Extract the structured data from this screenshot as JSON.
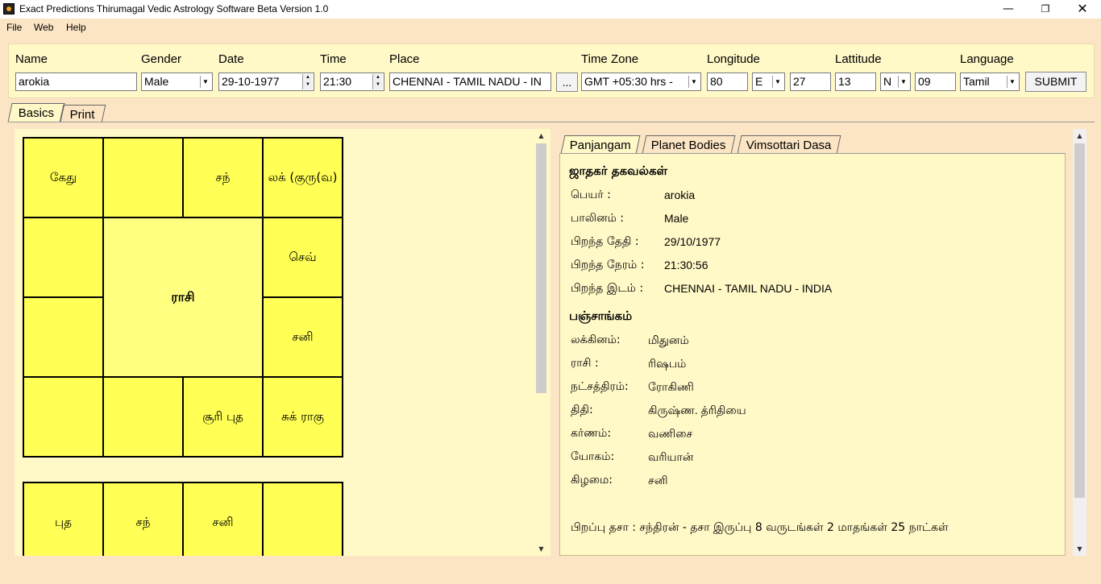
{
  "window": {
    "title": "Exact Predictions Thirumagal Vedic Astrology Software Beta Version 1.0",
    "minimize": "—",
    "maximize": "❐",
    "close": "✕"
  },
  "menu": [
    "File",
    "Web",
    "Help"
  ],
  "form": {
    "name_label": "Name",
    "name_value": "arokia",
    "gender_label": "Gender",
    "gender_value": "Male",
    "date_label": "Date",
    "date_value": "29-10-1977",
    "time_label": "Time",
    "time_value": "21:30",
    "place_label": "Place",
    "place_value": "CHENNAI - TAMIL NADU - IN",
    "browse_label": "...",
    "timezone_label": "Time Zone",
    "timezone_value": "GMT +05:30 hrs -",
    "longitude_label": "Longitude",
    "longitude_deg": "80",
    "longitude_dir": "E",
    "longitude_min": "27",
    "latitude_label": "Lattitude",
    "latitude_deg": "13",
    "latitude_dir": "N",
    "latitude_min": "09",
    "language_label": "Language",
    "language_value": "Tamil",
    "submit_label": "SUBMIT"
  },
  "main_tabs": [
    "Basics",
    "Print"
  ],
  "rasi_chart": {
    "center_label": "ராசி",
    "cells": [
      "கேது",
      "",
      "சந்",
      "லக் (குரு(வ)",
      "",
      "செவ்",
      "",
      "சனி",
      "",
      "",
      "சூரி புத",
      "சுக் ராகு"
    ]
  },
  "second_chart": {
    "cells": [
      "புத",
      "சந்",
      "சனி",
      ""
    ]
  },
  "info_tabs": [
    "Panjangam",
    "Planet Bodies",
    "Vimsottari Dasa"
  ],
  "panjangam": {
    "person_heading": "ஜாதகர் தகவல்கள்",
    "person_rows": [
      {
        "key": "பெயர் :",
        "value": "arokia"
      },
      {
        "key": "பாலினம் :",
        "value": "Male"
      },
      {
        "key": "பிறந்த தேதி :",
        "value": "29/10/1977"
      },
      {
        "key": "பிறந்த நேரம் :",
        "value": "21:30:56"
      },
      {
        "key": "பிறந்த இடம் :",
        "value": "CHENNAI - TAMIL NADU - INDIA"
      }
    ],
    "panchang_heading": "பஞ்சாங்கம்",
    "panchang_rows": [
      {
        "key": "லக்கினம்:",
        "value": "மிதுனம்"
      },
      {
        "key": "ராசி :",
        "value": "ரிஷபம்"
      },
      {
        "key": "நட்சத்திரம்:",
        "value": "ரோகிணி"
      },
      {
        "key": "திதி:",
        "value": "கிருஷ்ண. த்ரிதியை"
      },
      {
        "key": "கர்ணம்:",
        "value": "வணிசை"
      },
      {
        "key": "யோகம்:",
        "value": "வரியான்"
      },
      {
        "key": "கிழமை:",
        "value": "சனி"
      }
    ],
    "dasa_line": "பிறப்பு தசா : சந்திரன் - தசா இருப்பு 8 வருடங்கள் 2 மாதங்கள் 25 நாட்கள்"
  },
  "icons": {
    "scroll_up": "▲",
    "scroll_down": "▼",
    "dropdown": "▼",
    "spin_up": "▲",
    "spin_down": "▼"
  }
}
